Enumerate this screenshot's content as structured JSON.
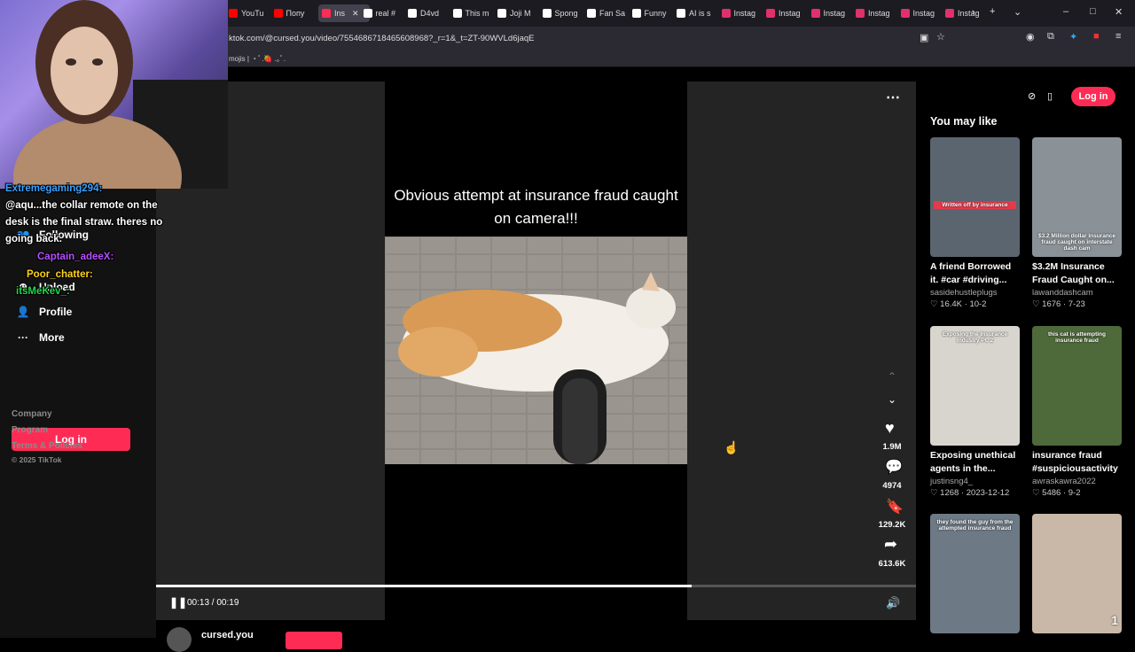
{
  "browser": {
    "tabs": [
      {
        "label": "YouTu",
        "color": "#ff0000"
      },
      {
        "label": "Попу",
        "color": "#ff0000"
      },
      {
        "label": "Ins",
        "color": "#fe2c55"
      },
      {
        "label": "real #",
        "color": "#ffffff"
      },
      {
        "label": "D4vd",
        "color": "#ffffff"
      },
      {
        "label": "This m",
        "color": "#ffffff"
      },
      {
        "label": "Joji M",
        "color": "#ffffff"
      },
      {
        "label": "Spong",
        "color": "#ffffff"
      },
      {
        "label": "Fan Sa",
        "color": "#ffffff"
      },
      {
        "label": "Funny",
        "color": "#ffffff"
      },
      {
        "label": "AI is s",
        "color": "#ffffff"
      },
      {
        "label": "Instag",
        "color": "#e1306c"
      },
      {
        "label": "Instag",
        "color": "#e1306c"
      },
      {
        "label": "Instag",
        "color": "#e1306c"
      },
      {
        "label": "Instag",
        "color": "#e1306c"
      },
      {
        "label": "Instag",
        "color": "#e1306c"
      },
      {
        "label": "Instag",
        "color": "#e1306c"
      }
    ],
    "url": "ktok.com/@cursed.you/video/7554686718465608968?_r=1&_t=ZT-90WVLd6jaqE",
    "bookmark_text": "mojis | ・ﾟ.🍓 .｡ﾟ."
  },
  "sidebar": {
    "items": [
      {
        "label": "Following",
        "icon": "following-icon"
      },
      {
        "label": "Upload",
        "icon": "upload-icon"
      },
      {
        "label": "Profile",
        "icon": "profile-icon"
      },
      {
        "label": "More",
        "icon": "more-icon"
      }
    ],
    "login_label": "Log in",
    "footer": [
      "Company",
      "Program",
      "Terms & Policies",
      "© 2025 TikTok"
    ]
  },
  "chat": {
    "lines": [
      "Extremegaming294:",
      "@aqu...the collar remote on the",
      "desk is the final straw. theres no",
      "going back.",
      "Captain_adeeX:",
      "Poor_chatter:",
      "itsMeKev_:"
    ]
  },
  "video": {
    "caption": "Obvious attempt at insurance fraud caught on camera!!!",
    "time": "00:13 / 00:19",
    "progress": 0.705,
    "likes": "1.9M",
    "comments": "4974",
    "saves": "129.2K",
    "shares": "613.6K",
    "author": "cursed.you"
  },
  "right": {
    "login_label": "Log in",
    "title": "You may like",
    "cards": [
      {
        "title": "A friend Borrowed it. #car #driving...",
        "author": "sasidehustleplugs",
        "likes": "16.4K",
        "date": "10-2",
        "thumb_text": "Written off by insurance",
        "thumb_color": "#5a6570"
      },
      {
        "title": "$3.2M Insurance Fraud Caught on...",
        "author": "lawanddashcam",
        "likes": "1676",
        "date": "7-23",
        "thumb_text": "$3.2 Million dollar insurance fraud caught on interstate dash cam",
        "thumb_color": "#8a9298"
      },
      {
        "title": "Exposing unethical agents in the...",
        "author": "justinsng4_",
        "likes": "1268",
        "date": "2023-12-12",
        "thumb_text": "Exposing the Insurance Industry Pt. 2",
        "thumb_color": "#d8d4ce"
      },
      {
        "title": "insurance fraud #suspiciousactivity",
        "author": "awraskawra2022",
        "likes": "5486",
        "date": "9-2",
        "thumb_text": "this cat is attempting insurance fraud",
        "thumb_color": "#4f6a3a"
      },
      {
        "title": "",
        "author": "",
        "likes": "",
        "date": "",
        "thumb_text": "they found the guy from the attempted insurance fraud",
        "thumb_color": "#6d7a86"
      },
      {
        "title": "",
        "author": "",
        "likes": "",
        "date": "",
        "thumb_text": "1",
        "thumb_color": "#c9b8a8"
      }
    ]
  }
}
